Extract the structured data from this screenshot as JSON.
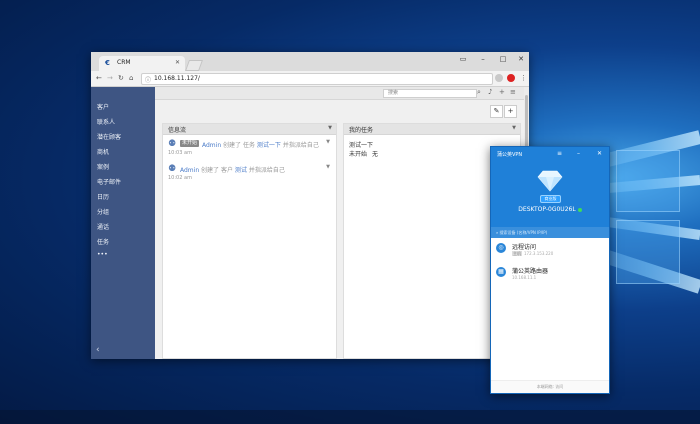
{
  "browser": {
    "tab_title": "CRM",
    "tab_favicon": "€",
    "url": "10.168.11.127/"
  },
  "crm": {
    "search_placeholder": "搜索",
    "sidebar": [
      "客户",
      "联系人",
      "潜在顾客",
      "商机",
      "案例",
      "电子邮件",
      "日历",
      "分组",
      "通话",
      "任务",
      "•••"
    ],
    "stream": {
      "title": "信息流",
      "items": [
        {
          "badge": "未开始",
          "actor": "Admin",
          "verb": "创建了 任务",
          "target": "测试一下",
          "suffix": "并指派给自己",
          "time": "10:03 am"
        },
        {
          "actor": "Admin",
          "verb": "创建了 客户",
          "target": "测试",
          "suffix": "并指派给自己",
          "time": "10:02 am"
        }
      ]
    },
    "tasks": {
      "title": "我的任务",
      "item_name": "测试一下",
      "item_status": "未开始",
      "item_due": "无"
    }
  },
  "vpn": {
    "title": "蒲公英VPN",
    "edition": "商业版",
    "hostname": "DESKTOP-0G0U26L",
    "search_placeholder": "搜索设备 (名称/VPN IP/IP)",
    "devices": [
      {
        "name": "远程访问",
        "tag": "主机",
        "ip": "172.3.153.220"
      },
      {
        "name": "蒲公英路由器",
        "ip": "10.168.11.1"
      }
    ],
    "footer": "本端网络: 访问"
  }
}
